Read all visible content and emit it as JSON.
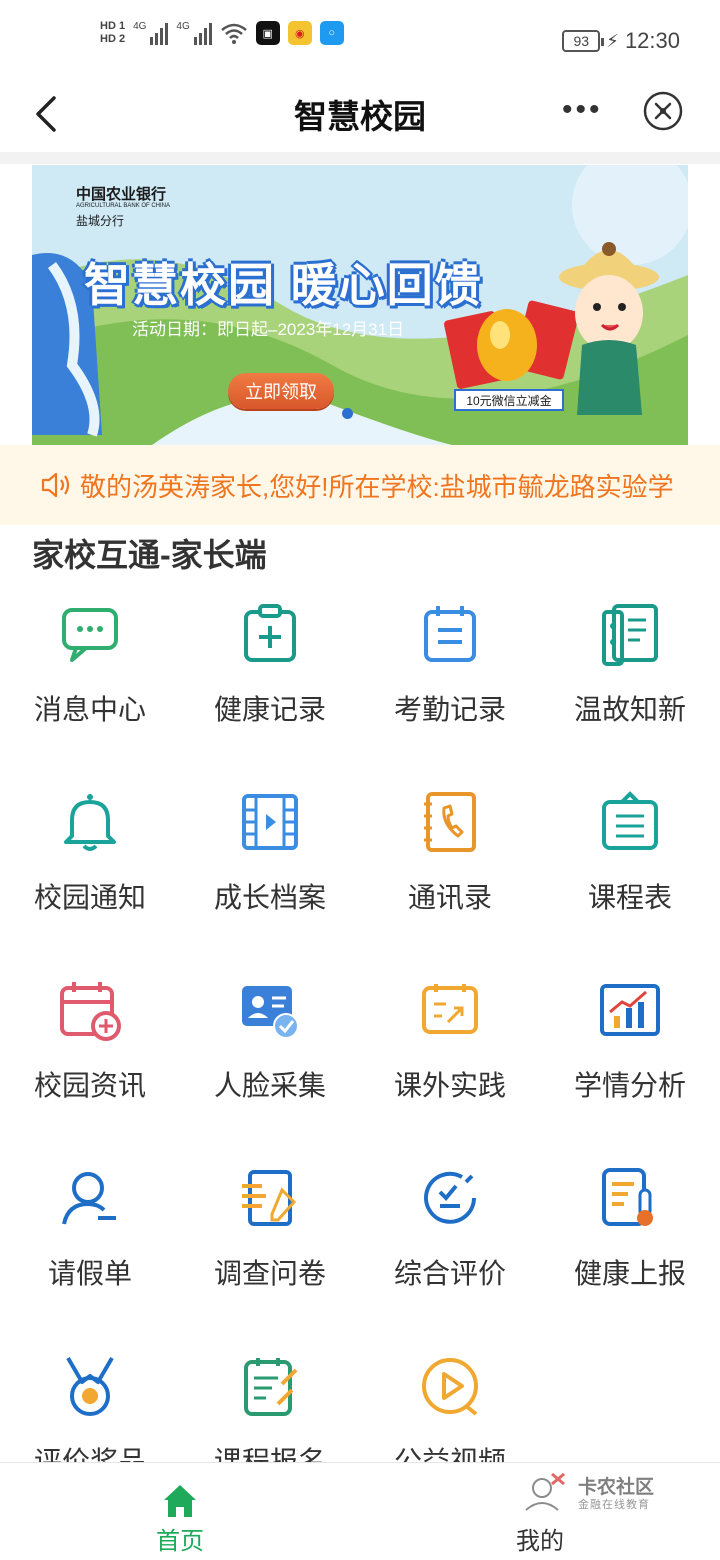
{
  "status_bar": {
    "hd1": "HD 1",
    "hd2": "HD 2",
    "sig1": "4G",
    "sig2": "4G",
    "battery": "93",
    "time": "12:30"
  },
  "nav": {
    "title": "智慧校园"
  },
  "banner": {
    "bank_name": "中国农业银行",
    "bank_en": "AGRICULTURAL BANK OF CHINA",
    "branch": "盐城分行",
    "headline": "智慧校园  暖心回馈",
    "date": "活动日期：即日起–2023年12月31日",
    "button": "立即领取",
    "coupon": "10元微信立减金"
  },
  "notice": {
    "text": "敬的汤英涛家长,您好!所在学校:盐城市毓龙路实验学"
  },
  "section": {
    "title": "家校互通-家长端"
  },
  "grid": [
    {
      "label": "消息中心",
      "icon": "message-icon",
      "color": "#2fae6f"
    },
    {
      "label": "健康记录",
      "icon": "health-record-icon",
      "color": "#1a9a8a"
    },
    {
      "label": "考勤记录",
      "icon": "attendance-icon",
      "color": "#3a8de0"
    },
    {
      "label": "温故知新",
      "icon": "notebook-icon",
      "color": "#1a9a8a"
    },
    {
      "label": "校园通知",
      "icon": "bell-icon",
      "color": "#1aa39a"
    },
    {
      "label": "成长档案",
      "icon": "film-icon",
      "color": "#3a8de0"
    },
    {
      "label": "通讯录",
      "icon": "contacts-icon",
      "color": "#e8962a"
    },
    {
      "label": "课程表",
      "icon": "schedule-icon",
      "color": "#1aa39a"
    },
    {
      "label": "校园资讯",
      "icon": "calendar-add-icon",
      "color": "#e05a6e"
    },
    {
      "label": "人脸采集",
      "icon": "face-id-icon",
      "color": "#3a7fd8"
    },
    {
      "label": "课外实践",
      "icon": "practice-icon",
      "color": "#f0a830"
    },
    {
      "label": "学情分析",
      "icon": "analysis-chart-icon",
      "color": "#1e6ec8"
    },
    {
      "label": "请假单",
      "icon": "leave-user-icon",
      "color": "#1e6ec8"
    },
    {
      "label": "调查问卷",
      "icon": "survey-icon",
      "color": "#1e6ec8"
    },
    {
      "label": "综合评价",
      "icon": "evaluation-icon",
      "color": "#1e6ec8"
    },
    {
      "label": "健康上报",
      "icon": "health-report-icon",
      "color": "#1e6ec8"
    },
    {
      "label": "评价奖品",
      "icon": "medal-icon",
      "color": "#1e6ec8"
    },
    {
      "label": "课程报名",
      "icon": "course-signup-icon",
      "color": "#2a9a70"
    },
    {
      "label": "公益视频",
      "icon": "video-play-icon",
      "color": "#f0a830"
    }
  ],
  "tabbar": {
    "home": "首页",
    "mine": "我的",
    "active_color": "#1eaa5a"
  },
  "watermark": {
    "title": "卡农社区",
    "subtitle": "金融在线教育"
  }
}
